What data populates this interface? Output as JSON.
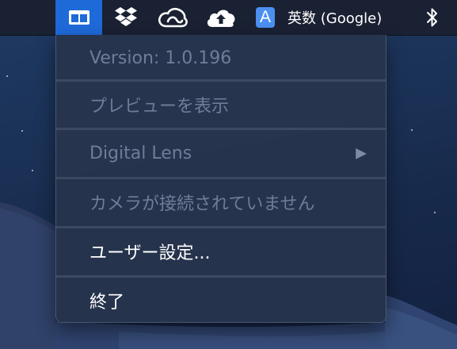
{
  "menubar": {
    "app_icon": "split-window-icon",
    "dropbox_icon": "dropbox-icon",
    "creative_cloud_icon": "creative-cloud-icon",
    "upload_icon": "cloud-upload-icon",
    "input_source": {
      "badge": "A",
      "label": "英数 (Google)"
    },
    "bluetooth_icon": "bluetooth-icon"
  },
  "menu": {
    "items": [
      {
        "label": "Version: 1.0.196",
        "enabled": false
      },
      {
        "label": "プレビューを表示",
        "enabled": false
      },
      {
        "label": "Digital Lens",
        "enabled": false,
        "submenu_arrow": "▶"
      },
      {
        "label": "カメラが接続されていません",
        "enabled": false
      },
      {
        "label": "ユーザー設定...",
        "enabled": true
      },
      {
        "label": "終了",
        "enabled": true
      }
    ]
  },
  "colors": {
    "menubar_bg": "#1a2133",
    "app_icon_highlight": "#1e6ad9",
    "menu_bg": "#27344d",
    "disabled_text": "#6e7d98",
    "enabled_text": "#ffffff",
    "input_badge": "#4b8ff0"
  }
}
